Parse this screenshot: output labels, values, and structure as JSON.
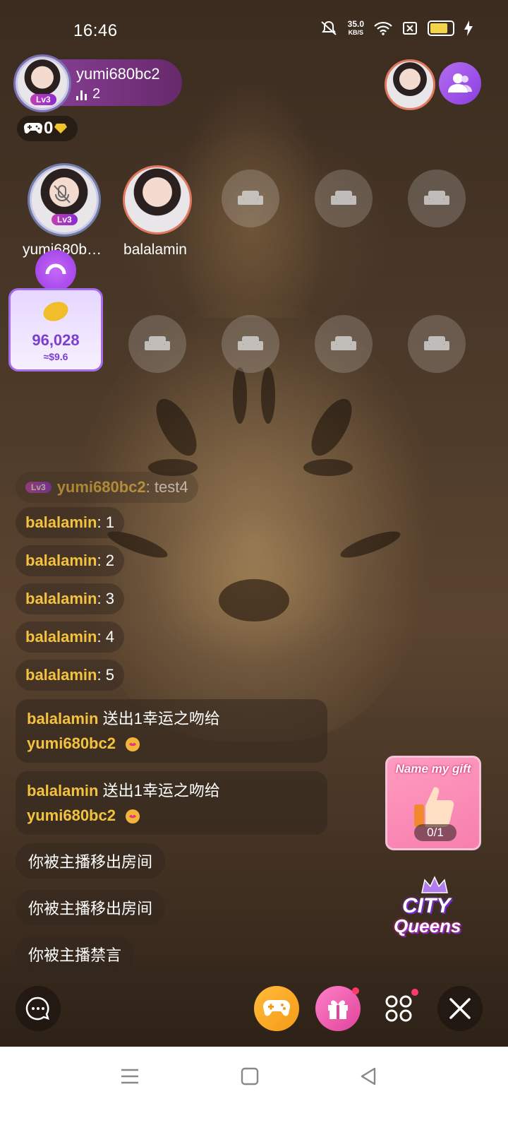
{
  "status_bar": {
    "time": "16:46",
    "net_speed_value": "35.0",
    "net_speed_unit": "KB/S"
  },
  "host": {
    "name": "yumi680bc2",
    "level": "Lv3",
    "listener_count": "2"
  },
  "game_counter": {
    "value": "0"
  },
  "seats": {
    "seat1": {
      "name": "yumi680b…",
      "level": "Lv3"
    },
    "seat2": {
      "name": "balalamin"
    }
  },
  "coin_card": {
    "value": "96,028",
    "usd": "≈$9.6"
  },
  "chat": {
    "first_message": {
      "level": "Lv3",
      "user": "yumi680bc2",
      "text": " : test4"
    },
    "messages": [
      {
        "user": "balalamin",
        "text": " : 1"
      },
      {
        "user": "balalamin",
        "text": " : 2"
      },
      {
        "user": "balalamin",
        "text": " : 3"
      },
      {
        "user": "balalamin",
        "text": " : 4"
      },
      {
        "user": "balalamin",
        "text": " : 5"
      }
    ],
    "gift_messages": [
      {
        "sender": "balalamin",
        "action": " 送出1幸运之吻给",
        "receiver": "yumi680bc2"
      },
      {
        "sender": "balalamin",
        "action": " 送出1幸运之吻给",
        "receiver": "yumi680bc2"
      }
    ],
    "system_messages": [
      "你被主播移出房间",
      "你被主播移出房间",
      "你被主播禁言"
    ]
  },
  "gift_card": {
    "title": "Name my gift",
    "progress": "0/1"
  },
  "city_logo": {
    "line1": "CITY",
    "line2": "Queens"
  },
  "colors": {
    "accent_purple": "#9c3ae6",
    "username_gold": "#f3c23e",
    "gift_pink": "#f77fae"
  }
}
